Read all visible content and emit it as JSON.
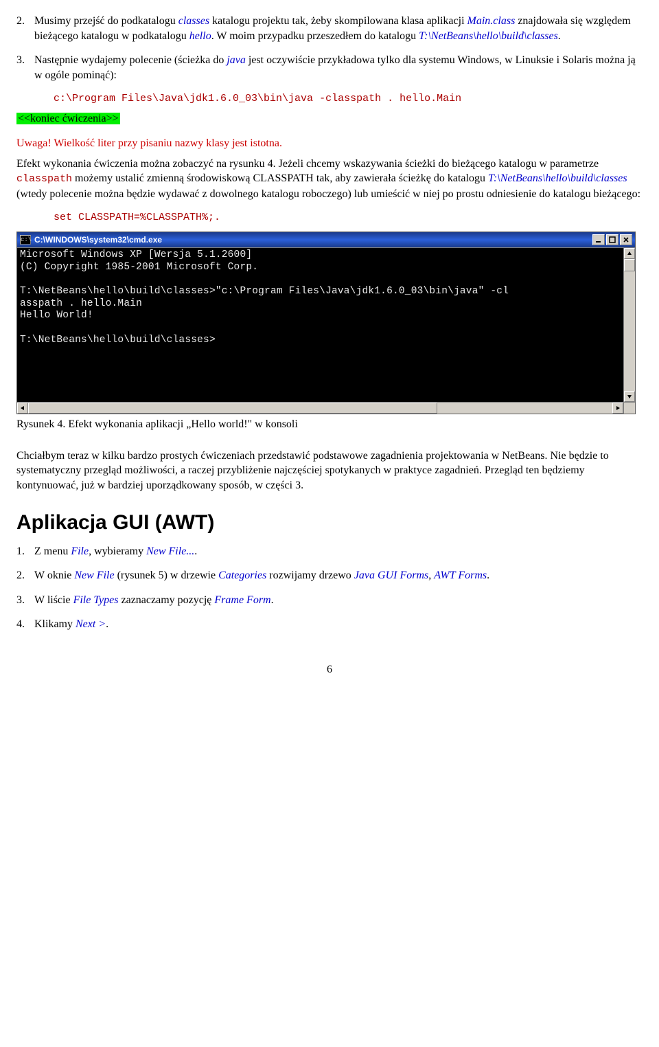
{
  "exercise_part1": {
    "items": [
      {
        "num": "2.",
        "pre": "Musimy przejść do podkatalogu ",
        "classes": "classes",
        "mid1": " katalogu projektu tak, żeby skompilowana klasa aplikacji ",
        "mainclass": "Main.class",
        "mid2": " znajdowała się względem bieżącego katalogu w podkatalogu ",
        "hello": "hello",
        "mid3": ". W moim przypadku przeszedłem do katalogu ",
        "path": "T:\\NetBeans\\hello\\build\\classes",
        "end": "."
      },
      {
        "num": "3.",
        "pre": "Następnie wydajemy polecenie (ścieżka do ",
        "java": "java",
        "mid1": " jest oczywiście przykładowa tylko dla systemu Windows, w Linuksie i Solaris można ją w ogóle pominąć):"
      }
    ],
    "code1": "c:\\Program Files\\Java\\jdk1.6.0_03\\bin\\java -classpath . hello.Main",
    "end_marker": "<<koniec ćwiczenia>>"
  },
  "warning": "Uwaga! Wielkość liter przy pisaniu nazwy klasy jest istotna.",
  "effect_para": {
    "s1": "Efekt wykonania ćwiczenia można zobaczyć na rysunku 4. Jeżeli chcemy wskazywania ścieżki do bieżącego katalogu w parametrze ",
    "classpath": "classpath",
    "s2": " możemy ustalić zmienną środowiskową CLASSPATH tak, aby zawierała ścieżkę do katalogu ",
    "path": "T:\\NetBeans\\hello\\build\\classes",
    "s3": " (wtedy polecenie można będzie wydawać z dowolnego katalogu roboczego) lub umieścić w niej po prostu odniesienie do katalogu bieżącego:"
  },
  "code2": "set CLASSPATH=%CLASSPATH%;.",
  "cmd_window": {
    "icon_text": "c:\\",
    "title": "C:\\WINDOWS\\system32\\cmd.exe",
    "lines": [
      "Microsoft Windows XP [Wersja 5.1.2600]",
      "(C) Copyright 1985-2001 Microsoft Corp.",
      "",
      "T:\\NetBeans\\hello\\build\\classes>\"c:\\Program Files\\Java\\jdk1.6.0_03\\bin\\java\" -cl",
      "asspath . hello.Main",
      "Hello World!",
      "",
      "T:\\NetBeans\\hello\\build\\classes>"
    ]
  },
  "figure_caption": "Rysunek 4. Efekt wykonania aplikacji „Hello world!\" w konsoli",
  "bridge_para": "Chciałbym teraz w kilku bardzo prostych ćwiczeniach przedstawić podstawowe zagadnienia projektowania w NetBeans. Nie będzie to systematyczny przegląd możliwości, a raczej przybliżenie najczęściej spotykanych w praktyce zagadnień. Przegląd ten będziemy kontynuować, już w bardziej uporządkowany sposób, w części 3.",
  "section_title": "Aplikacja GUI (AWT)",
  "gui_steps": {
    "items": [
      {
        "num": "1.",
        "parts": [
          {
            "t": "Z menu "
          },
          {
            "t": "File",
            "cls": "italic-blue"
          },
          {
            "t": ", wybieramy "
          },
          {
            "t": "New File...",
            "cls": "italic-blue"
          },
          {
            "t": "."
          }
        ]
      },
      {
        "num": "2.",
        "parts": [
          {
            "t": "W oknie "
          },
          {
            "t": "New File",
            "cls": "italic-blue"
          },
          {
            "t": " (rysunek 5) w drzewie "
          },
          {
            "t": "Categories",
            "cls": "italic-blue"
          },
          {
            "t": " rozwijamy drzewo "
          },
          {
            "t": "Java GUI Forms",
            "cls": "italic-blue"
          },
          {
            "t": ", "
          },
          {
            "t": "AWT Forms",
            "cls": "italic-blue"
          },
          {
            "t": "."
          }
        ]
      },
      {
        "num": "3.",
        "parts": [
          {
            "t": "W liście "
          },
          {
            "t": "File Types",
            "cls": "italic-blue"
          },
          {
            "t": " zaznaczamy pozycję "
          },
          {
            "t": "Frame Form",
            "cls": "italic-blue"
          },
          {
            "t": "."
          }
        ]
      },
      {
        "num": "4.",
        "parts": [
          {
            "t": "Klikamy "
          },
          {
            "t": "Next >",
            "cls": "italic-blue"
          },
          {
            "t": "."
          }
        ]
      }
    ]
  },
  "page_number": "6"
}
